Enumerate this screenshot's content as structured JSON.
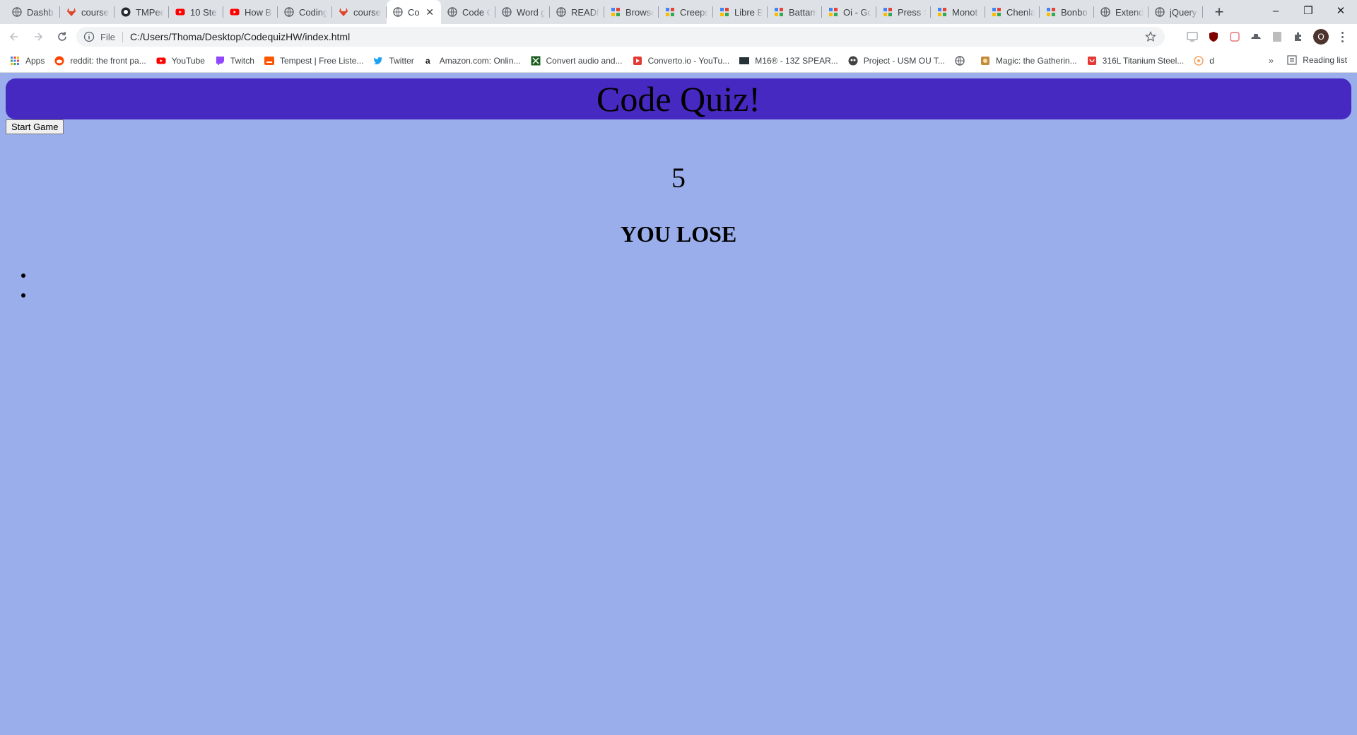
{
  "browser": {
    "tabs": [
      {
        "title": "Dashb",
        "icon": "globe-icon"
      },
      {
        "title": "course",
        "icon": "gitlab-icon"
      },
      {
        "title": "TMPee",
        "icon": "github-icon"
      },
      {
        "title": "10 Ste",
        "icon": "youtube-icon"
      },
      {
        "title": "How B",
        "icon": "youtube-icon"
      },
      {
        "title": "Coding",
        "icon": "globe-icon"
      },
      {
        "title": "course",
        "icon": "gitlab-icon"
      },
      {
        "title": "Co",
        "icon": "globe-icon",
        "active": true
      },
      {
        "title": "Code C",
        "icon": "globe-icon"
      },
      {
        "title": "Word g",
        "icon": "globe-icon"
      },
      {
        "title": "READN",
        "icon": "globe-icon"
      },
      {
        "title": "Browse",
        "icon": "puzzle-icon"
      },
      {
        "title": "Creeps",
        "icon": "puzzle-icon"
      },
      {
        "title": "Libre B",
        "icon": "puzzle-icon"
      },
      {
        "title": "Battam",
        "icon": "puzzle-icon"
      },
      {
        "title": "Oi - Go",
        "icon": "puzzle-icon"
      },
      {
        "title": "Press S",
        "icon": "puzzle-icon"
      },
      {
        "title": "Monot",
        "icon": "puzzle-icon"
      },
      {
        "title": "Chenla",
        "icon": "puzzle-icon"
      },
      {
        "title": "Bonbo",
        "icon": "puzzle-icon"
      },
      {
        "title": "Extend",
        "icon": "globe-icon"
      },
      {
        "title": "jQuery",
        "icon": "globe-icon"
      }
    ],
    "new_tab": "+",
    "window_controls": {
      "minimize": "–",
      "restore": "❐",
      "close": "✕"
    },
    "address": {
      "protocol": "File",
      "url": "C:/Users/Thoma/Desktop/CodequizHW/index.html"
    },
    "profile_initial": "O",
    "bookmarks": [
      {
        "label": "Apps",
        "icon": "apps-grid-icon"
      },
      {
        "label": "reddit: the front pa...",
        "icon": "reddit-icon"
      },
      {
        "label": "YouTube",
        "icon": "youtube-icon"
      },
      {
        "label": "Twitch",
        "icon": "twitch-icon"
      },
      {
        "label": "Tempest | Free Liste...",
        "icon": "soundcloud-icon"
      },
      {
        "label": "Twitter",
        "icon": "twitter-icon"
      },
      {
        "label": "Amazon.com: Onlin...",
        "icon": "amazon-icon"
      },
      {
        "label": "Convert audio and...",
        "icon": "convert-icon"
      },
      {
        "label": "Converto.io - YouTu...",
        "icon": "converto-icon"
      },
      {
        "label": "M16® - 13Z SPEAR...",
        "icon": "crkt-icon"
      },
      {
        "label": "Project - USM OU T...",
        "icon": "project-icon"
      },
      {
        "label": "",
        "icon": "globe-icon"
      },
      {
        "label": "Magic: the Gatherin...",
        "icon": "magic-icon"
      },
      {
        "label": "316L Titanium Steel...",
        "icon": "steel-icon"
      },
      {
        "label": "d",
        "icon": "d-icon"
      }
    ],
    "bookmarks_more": "»",
    "reading_list": "Reading list"
  },
  "page": {
    "title": "Code Quiz!",
    "start_button": "Start Game",
    "timer": "5",
    "result": "YOU LOSE",
    "answers": [
      "",
      ""
    ]
  },
  "colors": {
    "header_bg": "#4629c0",
    "page_bg": "#9aaeec"
  }
}
